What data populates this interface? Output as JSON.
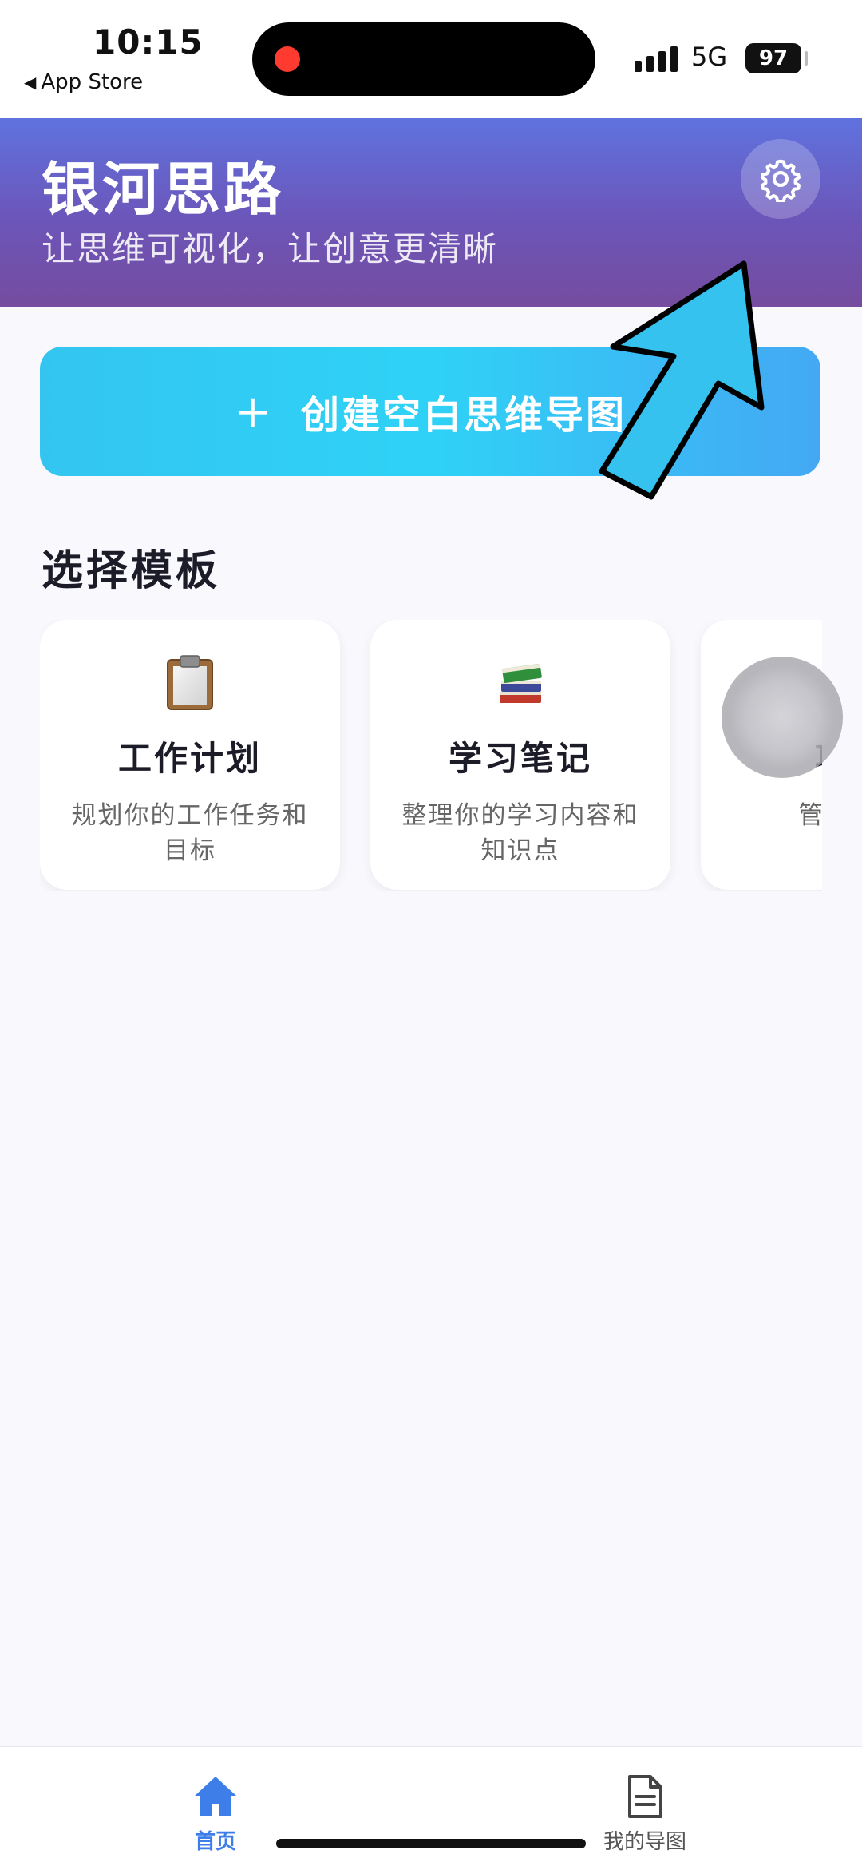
{
  "status_bar": {
    "time": "10:15",
    "back_label": "App Store",
    "network": "5G",
    "battery": "97"
  },
  "header": {
    "title": "银河思路",
    "subtitle": "让思维可视化，让创意更清晰",
    "settings_icon": "gear-icon"
  },
  "create_button": {
    "icon": "+",
    "label": "创建空白思维导图"
  },
  "templates": {
    "section_title": "选择模板",
    "items": [
      {
        "icon": "clipboard-icon",
        "title": "工作计划",
        "description": "规划你的工作任务和目标"
      },
      {
        "icon": "books-icon",
        "title": "学习笔记",
        "description": "整理你的学习内容和知识点"
      },
      {
        "icon": "project-icon",
        "title": "项目",
        "description": "管理项目"
      }
    ]
  },
  "tab_bar": {
    "items": [
      {
        "label": "首页",
        "icon": "home-icon",
        "active": true
      },
      {
        "label": "我的导图",
        "icon": "document-icon",
        "active": false
      }
    ]
  },
  "colors": {
    "header_start": "#5f72df",
    "header_end": "#754c9f",
    "create_button": "#2fd2f6",
    "active_tab": "#3d7ee8",
    "annotation_arrow": "#35c2ee"
  }
}
